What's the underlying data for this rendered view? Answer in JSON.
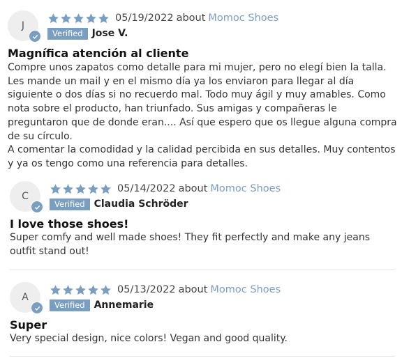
{
  "reviews": [
    {
      "initial": "J",
      "date": "05/19/2022",
      "about_label": "about",
      "store": "Momoc Shoes",
      "verified_label": "Verified",
      "name": "Jose V.",
      "rating": 5,
      "title": "Magnífica atención al cliente",
      "body": [
        "Compre unos zapatos como detalle para mi mujer, pero no elegí bien la talla. Les mande un mail y en el mismo día ya los enviaron para llegar al día siguiente o dos días si no recuerdo mal. Todo muy ágil y muy amables. Como nota sobre el producto, han triunfado. Sus amigas y compañeras le preguntaron que de donde eran.... Así que espero que os llegue alguna compra de su círculo.",
        "A comentar la comodidad y la calidad percibida en sus detalles. Muy contentos y ya os tengo como una referencia para detalles."
      ]
    },
    {
      "initial": "C",
      "date": "05/14/2022",
      "about_label": "about",
      "store": "Momoc Shoes",
      "verified_label": "Verified",
      "name": "Claudia Schröder",
      "rating": 5,
      "title": "I love those shoes!",
      "body": [
        "Super comfy and well made shoes! They fit perfectly and make any jeans outfit stand out!"
      ]
    },
    {
      "initial": "A",
      "date": "05/13/2022",
      "about_label": "about",
      "store": "Momoc Shoes",
      "verified_label": "Verified",
      "name": "Annemarie",
      "rating": 5,
      "title": "Super",
      "body": [
        "Very special design, nice colors! Vegan and good quality."
      ]
    }
  ],
  "colors": {
    "star": "#7a9ec0",
    "verified_badge": "#7a9ec0",
    "store_link": "#7a9ec0",
    "avatar_bg": "#eeeeee"
  },
  "icons": [
    "star-icon",
    "verified-check-icon"
  ]
}
